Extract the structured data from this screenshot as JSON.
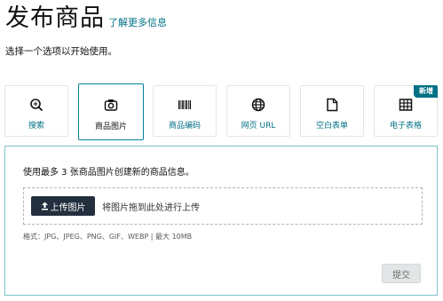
{
  "header": {
    "title": "发布商品",
    "learn_more": "了解更多信息",
    "subtitle": "选择一个选项以开始使用。"
  },
  "tabs": [
    {
      "label": "搜索",
      "icon": "search-icon",
      "active": false
    },
    {
      "label": "商品图片",
      "icon": "camera-icon",
      "active": true
    },
    {
      "label": "商品编码",
      "icon": "barcode-icon",
      "active": false
    },
    {
      "label": "网页 URL",
      "icon": "globe-icon",
      "active": false
    },
    {
      "label": "空白表单",
      "icon": "document-icon",
      "active": false
    },
    {
      "label": "电子表格",
      "icon": "spreadsheet-icon",
      "active": false,
      "badge": "新增"
    }
  ],
  "panel": {
    "description": "使用最多 3 张商品图片创建新的商品信息。",
    "upload_button": "上传图片",
    "drop_text": "将图片拖到此处进行上传",
    "formats": "格式：JPG、JPEG、PNG、GIF、WEBP | 最大 10MB",
    "submit_button": "提交"
  },
  "colors": {
    "link": "#007185",
    "active_border": "#008296",
    "upload_button_bg": "#232f3e",
    "badge_bg": "#007185"
  }
}
